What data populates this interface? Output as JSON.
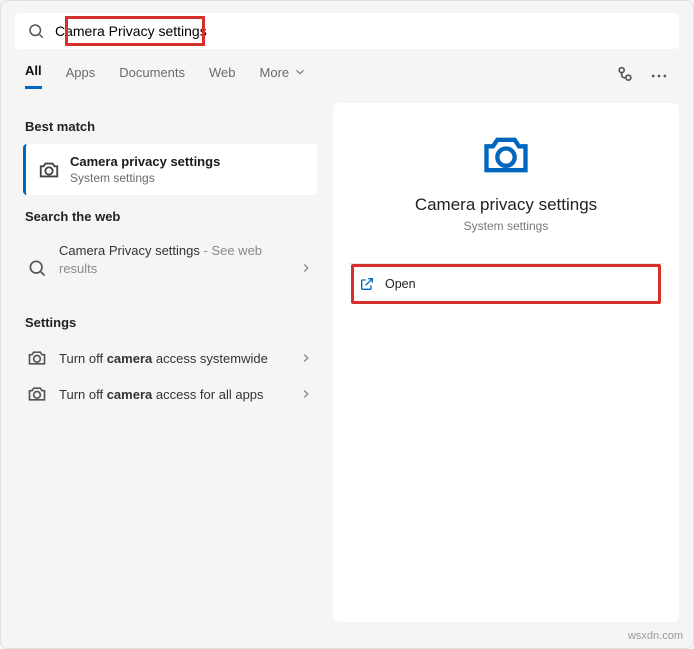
{
  "search": {
    "value": "Camera Privacy settings"
  },
  "tabs": {
    "all": "All",
    "apps": "Apps",
    "documents": "Documents",
    "web": "Web",
    "more": "More"
  },
  "left": {
    "best_match": "Best match",
    "best": {
      "title": "Camera privacy settings",
      "sub": "System settings"
    },
    "search_web": "Search the web",
    "web_item": {
      "title": "Camera Privacy settings",
      "suffix": " - See web results"
    },
    "settings": "Settings",
    "setting1_pre": "Turn off ",
    "setting1_bold": "camera",
    "setting1_post": " access systemwide",
    "setting2_pre": "Turn off ",
    "setting2_bold": "camera",
    "setting2_post": " access for all apps"
  },
  "right": {
    "title": "Camera privacy settings",
    "sub": "System settings",
    "open": "Open"
  },
  "watermark": "wsxdn.com"
}
